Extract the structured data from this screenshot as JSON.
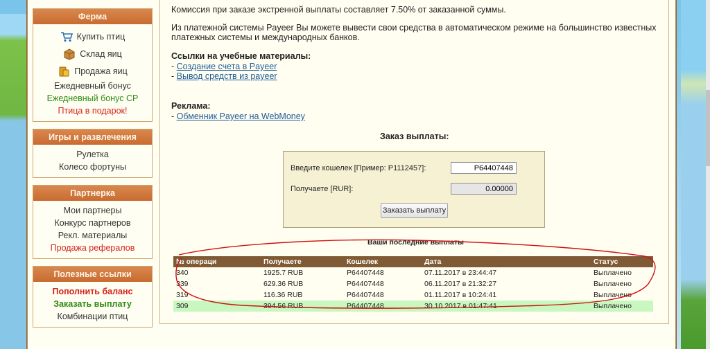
{
  "sidebar": {
    "farm": {
      "title": "Ферма",
      "icon_items": [
        {
          "label": "Купить птиц",
          "icon": "cart-icon"
        },
        {
          "label": "Склад яиц",
          "icon": "box-icon"
        },
        {
          "label": "Продажа яиц",
          "icon": "coins-icon"
        }
      ],
      "items": [
        {
          "label": "Ежедневный бонус"
        },
        {
          "label": "Ежедневный бонус СР"
        },
        {
          "label": "Птица в подарок!"
        }
      ]
    },
    "games": {
      "title": "Игры и развлечения",
      "items": [
        {
          "label": "Рулетка"
        },
        {
          "label": "Колесо фортуны"
        }
      ]
    },
    "partner": {
      "title": "Партнерка",
      "items": [
        {
          "label": "Мои партнеры"
        },
        {
          "label": "Конкурс партнеров"
        },
        {
          "label": "Рекл. материалы"
        },
        {
          "label": "Продажа рефералов"
        }
      ]
    },
    "links": {
      "title": "Полезные ссылки",
      "items": [
        {
          "label": "Пополнить баланс"
        },
        {
          "label": "Заказать выплату"
        },
        {
          "label": "Комбинации птиц"
        }
      ]
    }
  },
  "content": {
    "commission_text": "Комиссия при заказе экстренной выплаты составляет 7.50% от заказанной суммы.",
    "payeer_text_1": "Из платежной системы Payeer Вы можете вывести свои средства в автоматическом режиме на большинство известных",
    "payeer_text_2": "платежных системы и международных банков.",
    "study_heading": "Ссылки на учебные материалы:",
    "study_links": [
      "Создание счета в Payeer",
      "Вывод средств из payeer"
    ],
    "ad_heading": "Реклама:",
    "ad_links": [
      "Обменник Payeer на WebMoney"
    ],
    "link_prefix": "- "
  },
  "form": {
    "title": "Заказ выплаты:",
    "wallet_label": "Введите кошелек [Пример: P1112457]:",
    "wallet_value": "P64407448",
    "receive_label": "Получаете [RUR]:",
    "receive_value": "0.00000",
    "submit_label": "Заказать выплату"
  },
  "payouts": {
    "title": "Ваши последние выплаты",
    "columns": [
      "№ операци",
      "Получаете",
      "Кошелек",
      "Дата",
      "Статус"
    ],
    "rows": [
      {
        "id": "340",
        "amount": "1925.7 RUB",
        "wallet": "P64407448",
        "date": "07.11.2017 в 23:44:47",
        "status": "Выплачено"
      },
      {
        "id": "339",
        "amount": "629.36 RUB",
        "wallet": "P64407448",
        "date": "06.11.2017 в 21:32:27",
        "status": "Выплачено"
      },
      {
        "id": "319",
        "amount": "116.36 RUB",
        "wallet": "P64407448",
        "date": "01.11.2017 в 10:24:41",
        "status": "Выплачено"
      },
      {
        "id": "309",
        "amount": "394.56 RUB",
        "wallet": "P64407448",
        "date": "30.10.2017 в 01:47:41",
        "status": "Выплачено"
      }
    ]
  },
  "colors": {
    "sidebar_header": "#c96b31",
    "table_header": "#7f5a34",
    "status_paid": "#1e8c0c",
    "annotation_stroke": "#d01010"
  }
}
